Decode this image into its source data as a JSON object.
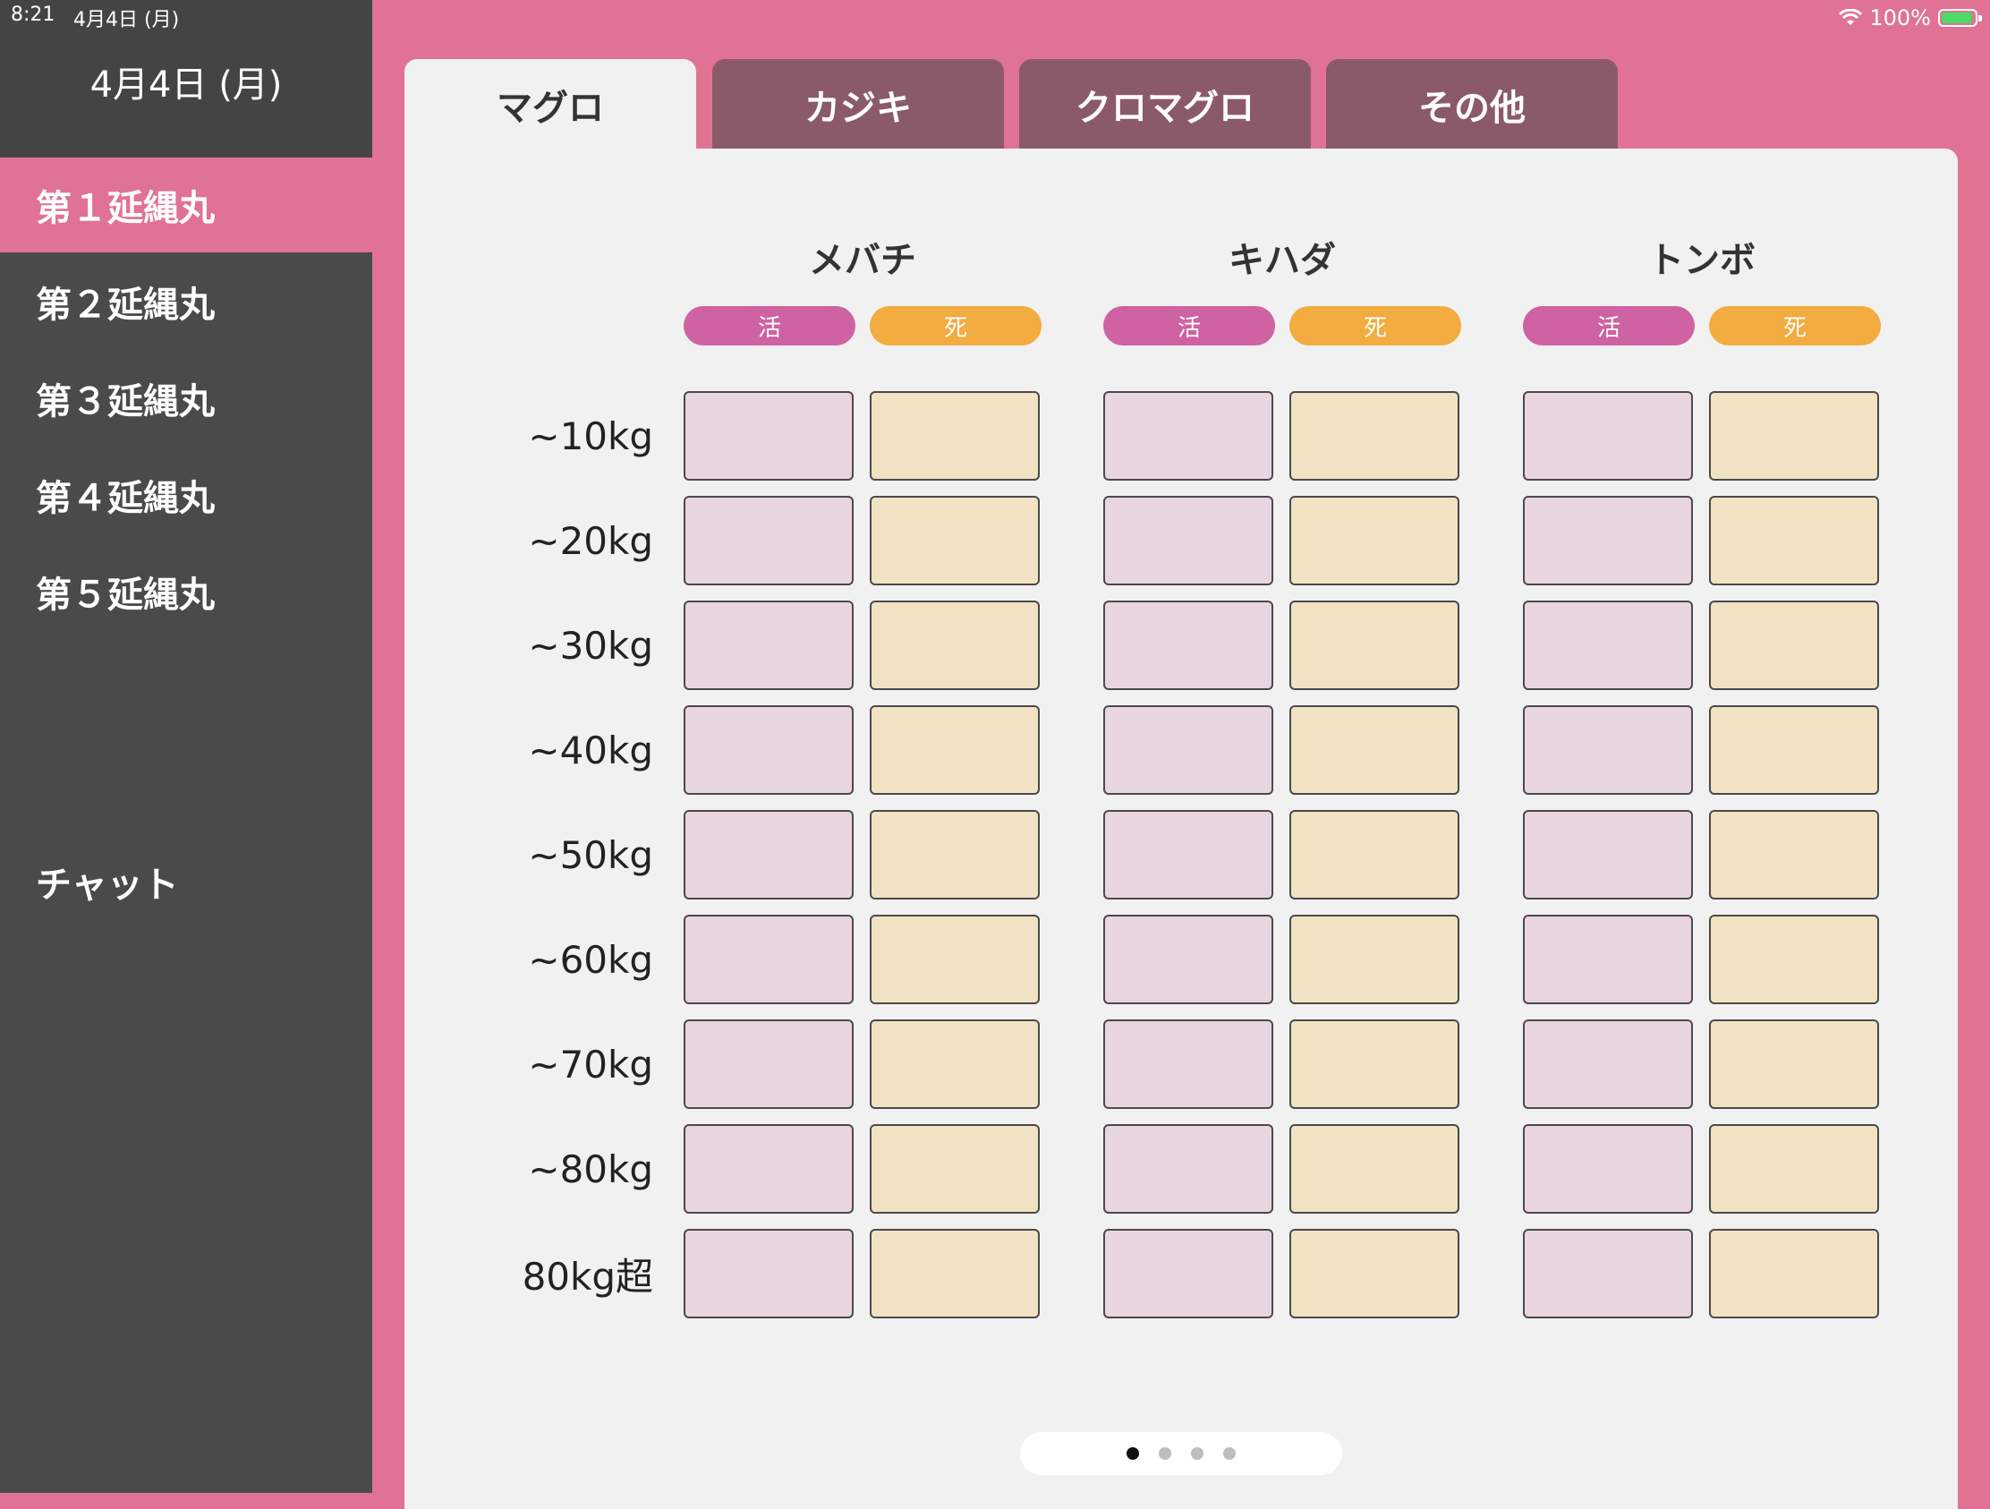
{
  "status_bar": {
    "time": "8:21",
    "date": "4月4日 (月)",
    "battery": "100%",
    "battery_level": 1.0
  },
  "sidebar": {
    "title": "4月4日 (月)",
    "ships": [
      {
        "label": "第１延縄丸",
        "active": true
      },
      {
        "label": "第２延縄丸",
        "active": false
      },
      {
        "label": "第３延縄丸",
        "active": false
      },
      {
        "label": "第４延縄丸",
        "active": false
      },
      {
        "label": "第５延縄丸",
        "active": false
      }
    ],
    "chat_label": "チャット"
  },
  "tabs": [
    {
      "label": "マグロ",
      "active": true
    },
    {
      "label": "カジキ",
      "active": false
    },
    {
      "label": "クロマグロ",
      "active": false
    },
    {
      "label": "その他",
      "active": false
    }
  ],
  "grid": {
    "live_label": "活",
    "dead_label": "死",
    "species": [
      "メバチ",
      "キハダ",
      "トンボ"
    ],
    "weights": [
      "~10kg",
      "~20kg",
      "~30kg",
      "~40kg",
      "~50kg",
      "~60kg",
      "~70kg",
      "~80kg",
      "80kg超"
    ]
  },
  "page_indicator": {
    "count": 4,
    "current": 1
  },
  "colors": {
    "accent": "#e07393",
    "sidebar_bg": "#4a4a4a",
    "tab_inactive": "#8b5a68",
    "live": "#cf62a2",
    "dead": "#f2ac40",
    "live_cell": "#e9d5e0",
    "dead_cell": "#f2e2c4"
  }
}
